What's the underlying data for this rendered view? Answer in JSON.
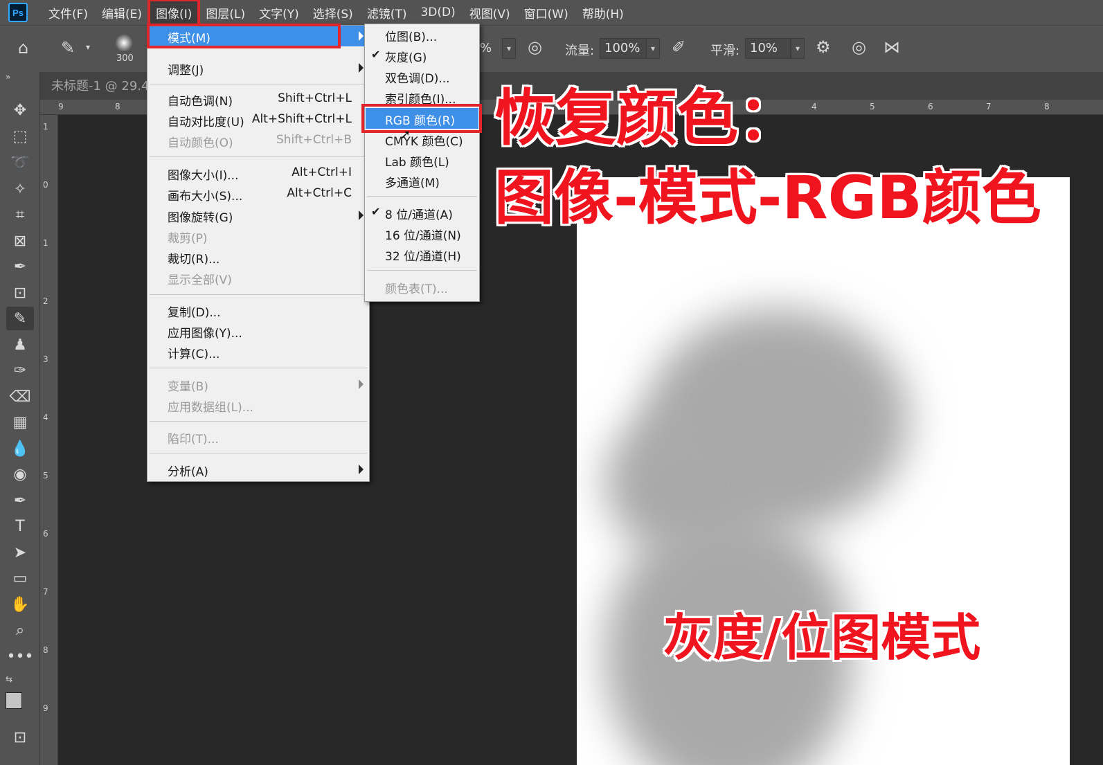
{
  "app": {
    "logo": "Ps"
  },
  "menubar": {
    "items": [
      "文件(F)",
      "编辑(E)",
      "图像(I)",
      "图层(L)",
      "文字(Y)",
      "选择(S)",
      "滤镜(T)",
      "3D(D)",
      "视图(V)",
      "窗口(W)",
      "帮助(H)"
    ],
    "active": "图像(I)"
  },
  "options": {
    "brush_size": "300",
    "opacity_suffix": "%",
    "flow_label": "流量:",
    "flow_value": "100%",
    "smooth_label": "平滑:",
    "smooth_value": "10%"
  },
  "document": {
    "tab_label": "未标题-1 @ 29.4"
  },
  "rulers": {
    "top": [
      "9",
      "8",
      "4",
      "5",
      "6",
      "7",
      "8"
    ],
    "left": [
      "1",
      "0",
      "1",
      "2",
      "3",
      "4",
      "5",
      "6",
      "7",
      "8",
      "9"
    ]
  },
  "image_menu": {
    "items": [
      {
        "label": "模式(M)",
        "submenu": true,
        "highlight": true
      },
      {
        "label": "调整(J)",
        "submenu": true
      },
      {
        "label": "自动色调(N)",
        "shortcut": "Shift+Ctrl+L"
      },
      {
        "label": "自动对比度(U)",
        "shortcut": "Alt+Shift+Ctrl+L"
      },
      {
        "label": "自动颜色(O)",
        "shortcut": "Shift+Ctrl+B",
        "disabled": true
      },
      {
        "label": "图像大小(I)...",
        "shortcut": "Alt+Ctrl+I"
      },
      {
        "label": "画布大小(S)...",
        "shortcut": "Alt+Ctrl+C"
      },
      {
        "label": "图像旋转(G)",
        "submenu": true
      },
      {
        "label": "裁剪(P)",
        "disabled": true
      },
      {
        "label": "裁切(R)..."
      },
      {
        "label": "显示全部(V)",
        "disabled": true
      },
      {
        "label": "复制(D)..."
      },
      {
        "label": "应用图像(Y)..."
      },
      {
        "label": "计算(C)..."
      },
      {
        "label": "变量(B)",
        "submenu": true,
        "disabled": true
      },
      {
        "label": "应用数据组(L)...",
        "disabled": true
      },
      {
        "label": "陷印(T)...",
        "disabled": true
      },
      {
        "label": "分析(A)",
        "submenu": true
      }
    ]
  },
  "mode_submenu": {
    "items": [
      {
        "label": "位图(B)..."
      },
      {
        "label": "灰度(G)",
        "checked": true
      },
      {
        "label": "双色调(D)..."
      },
      {
        "label": "索引颜色(I)..."
      },
      {
        "label": "RGB 颜色(R)",
        "highlight": true
      },
      {
        "label": "CMYK 颜色(C)"
      },
      {
        "label": "Lab 颜色(L)"
      },
      {
        "label": "多通道(M)"
      },
      {
        "label": "8 位/通道(A)",
        "checked": true
      },
      {
        "label": "16 位/通道(N)"
      },
      {
        "label": "32 位/通道(H)"
      },
      {
        "label": "颜色表(T)...",
        "disabled": true
      }
    ]
  },
  "annotations": {
    "heading_1": "恢复颜色：",
    "heading_2": "图像-模式-RGB颜色",
    "caption": "灰度/位图模式"
  },
  "colors": {
    "accent_red": "#e0262b",
    "menu_highlight": "#3d8fe8",
    "annotation_red": "#f0141e"
  },
  "tools": [
    "move-icon",
    "marquee-icon",
    "lasso-icon",
    "magic-wand-icon",
    "crop-icon",
    "frame-icon",
    "eyedropper-icon",
    "patch-icon",
    "brush-icon",
    "stamp-icon",
    "history-brush-icon",
    "eraser-icon",
    "gradient-icon",
    "blur-icon",
    "dodge-icon",
    "pen-icon",
    "type-icon",
    "path-select-icon",
    "rectangle-icon",
    "hand-icon",
    "zoom-icon",
    "more-icon"
  ]
}
